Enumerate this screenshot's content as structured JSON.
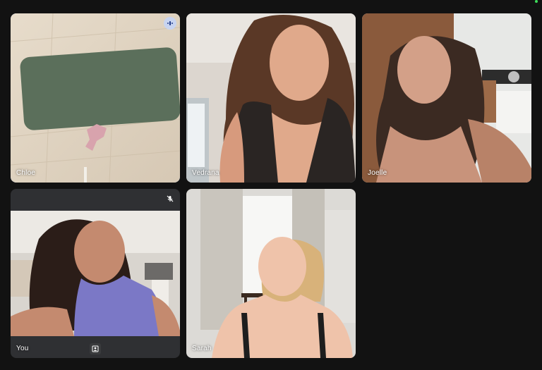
{
  "participants": [
    {
      "name": "Chloe",
      "speaking": true,
      "muted": false
    },
    {
      "name": "Vedrana",
      "speaking": false,
      "muted": false
    },
    {
      "name": "Joelle",
      "speaking": false,
      "muted": false
    },
    {
      "name": "You",
      "speaking": false,
      "muted": true
    },
    {
      "name": "Sarah",
      "speaking": false,
      "muted": false
    }
  ],
  "icons": {
    "speaking": "speaking-indicator-icon",
    "muted": "mic-off-icon",
    "self_view": "self-view-icon"
  },
  "colors": {
    "background": "#121212",
    "tile": "#2a2b2d",
    "active_border": "#8ab4f8",
    "name_text": "#ffffff"
  }
}
